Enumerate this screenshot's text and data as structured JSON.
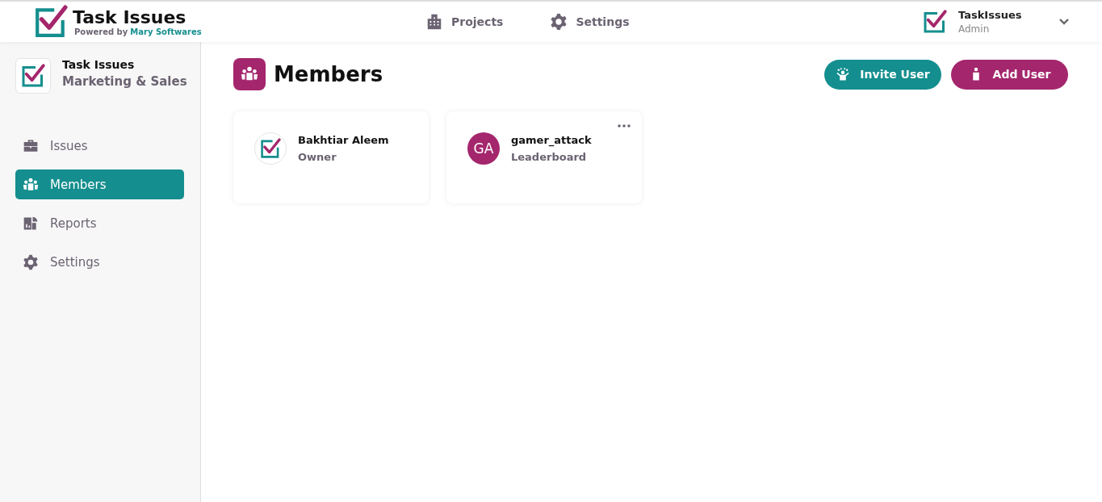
{
  "header": {
    "brand": "Task Issues",
    "tagline_prefix": "Powered by",
    "tagline_company": "Mary Softwares",
    "nav": [
      {
        "label": "Projects",
        "kind": "building"
      },
      {
        "label": "Settings",
        "kind": "gear"
      }
    ],
    "user": {
      "name": "TaskIssues",
      "role": "Admin"
    }
  },
  "sidebar": {
    "project": {
      "name": "Task Issues",
      "team": "Marketing & Sales"
    },
    "items": [
      {
        "label": "Issues",
        "kind": "briefcase",
        "selected": false
      },
      {
        "label": "Members",
        "kind": "group",
        "selected": true
      },
      {
        "label": "Reports",
        "kind": "report",
        "selected": false
      },
      {
        "label": "Settings",
        "kind": "gear",
        "selected": false
      }
    ]
  },
  "page": {
    "title": "Members",
    "actions": [
      {
        "label": "Invite User",
        "kind": "invite"
      },
      {
        "label": "Add User",
        "kind": "add"
      }
    ]
  },
  "members": [
    {
      "name": "Bakhtiar Aleem",
      "role": "Owner",
      "kind": "logo",
      "has_menu": false
    },
    {
      "name": "gamer_attack",
      "role": "Leaderboard",
      "kind": "initials",
      "initials": "GA",
      "color": "#a4266c",
      "has_menu": true
    }
  ]
}
